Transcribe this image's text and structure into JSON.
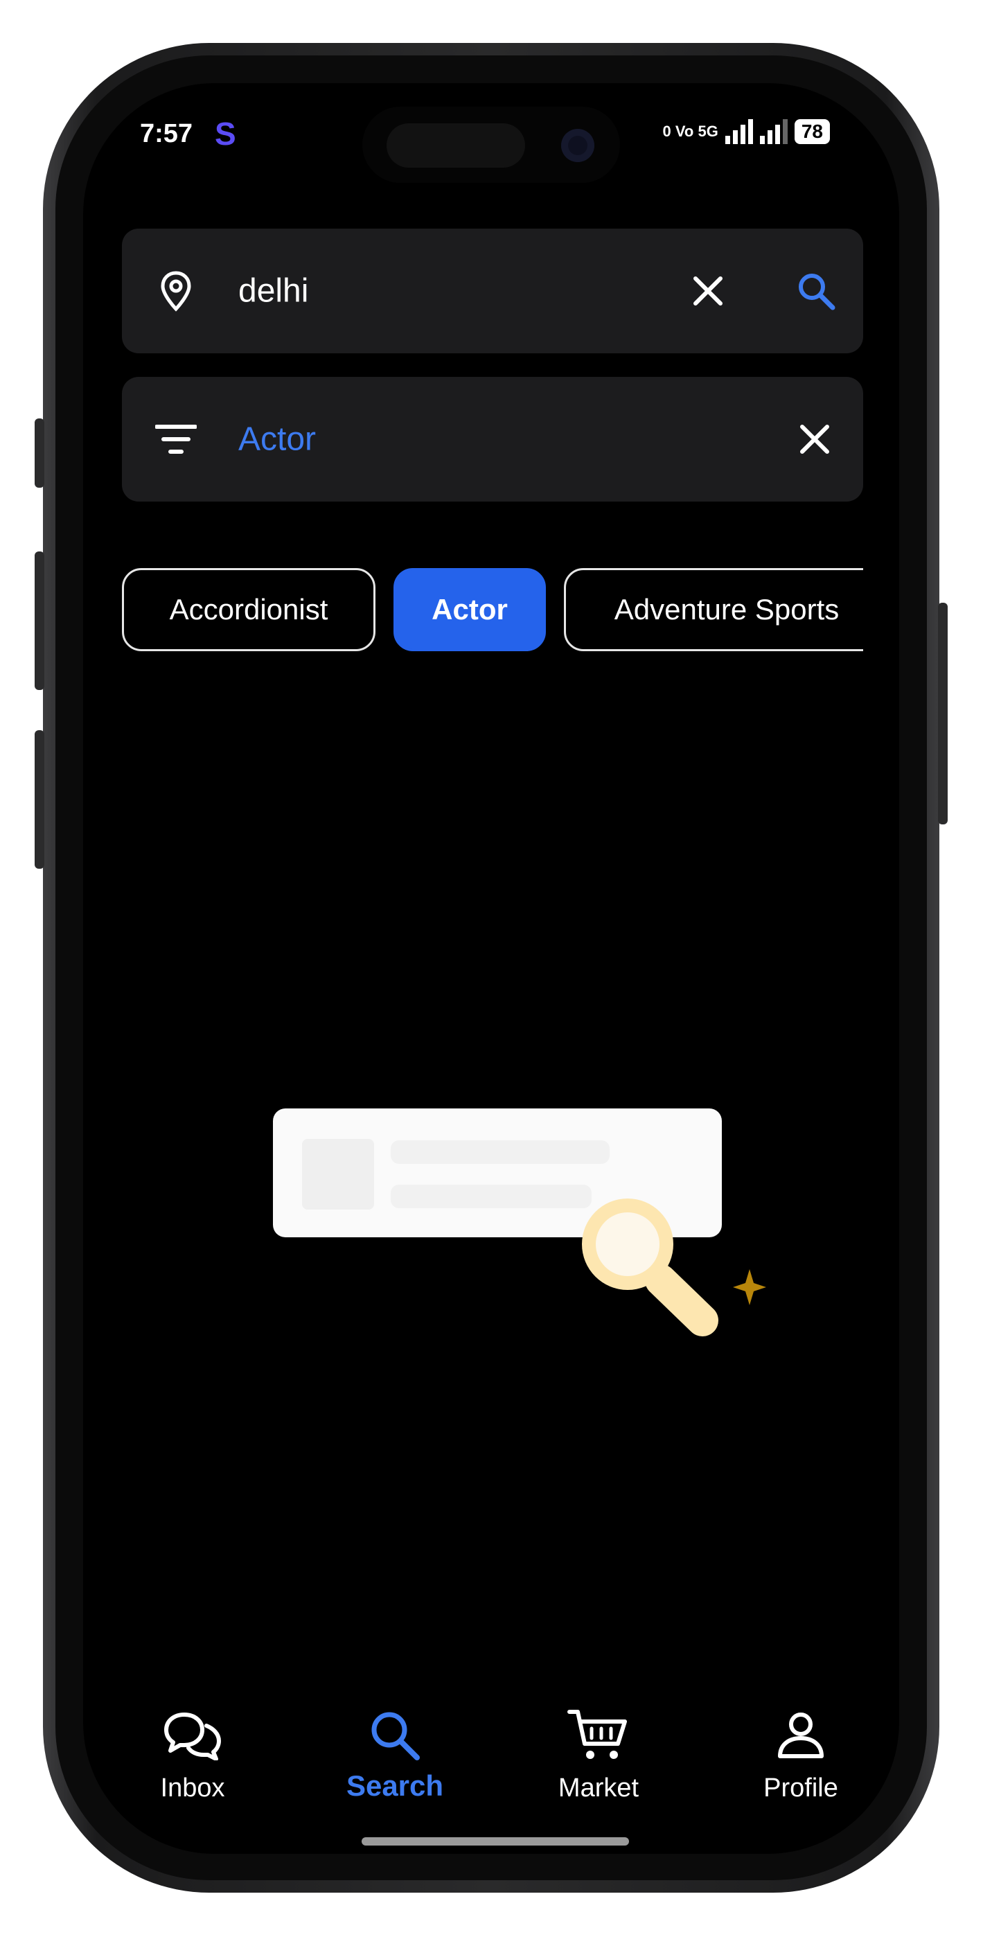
{
  "status_bar": {
    "time": "7:57",
    "app_badge": "S",
    "signal_text": "0 Vo 5G",
    "network": "5G",
    "battery": "78"
  },
  "location_search": {
    "icon": "location-pin-icon",
    "value": "delhi",
    "clear_icon": "close-icon",
    "search_icon": "search-icon"
  },
  "category_filter": {
    "icon": "filter-icon",
    "value": "Actor",
    "clear_icon": "close-icon"
  },
  "chips": [
    {
      "label": "Accordionist",
      "selected": false
    },
    {
      "label": "Actor",
      "selected": true
    },
    {
      "label": "Adventure Sports",
      "selected": false
    }
  ],
  "bottom_nav": [
    {
      "label": "Inbox",
      "icon": "chat-bubbles-icon",
      "active": false
    },
    {
      "label": "Search",
      "icon": "search-icon",
      "active": true
    },
    {
      "label": "Market",
      "icon": "cart-icon",
      "active": false
    },
    {
      "label": "Profile",
      "icon": "person-icon",
      "active": false
    }
  ],
  "colors": {
    "accent": "#2563eb",
    "accent_text": "#3d7bf0",
    "field_bg": "#1c1c1e",
    "screen_bg": "#000000",
    "illustration_accent": "#fde6b0"
  }
}
